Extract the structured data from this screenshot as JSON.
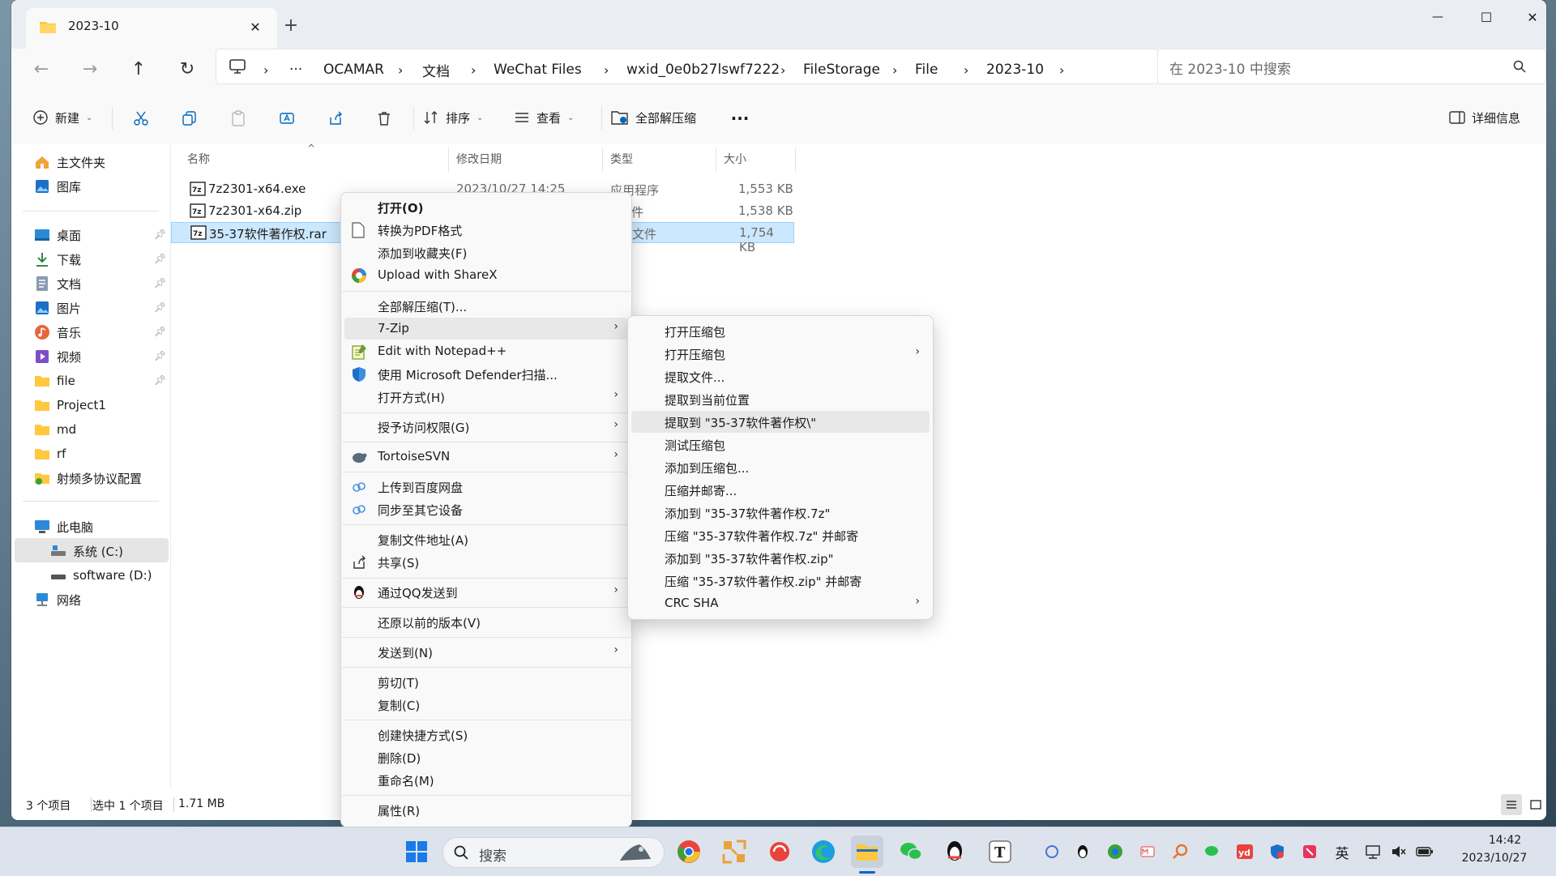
{
  "window": {
    "tab_title": "2023-10",
    "controls": {
      "minimize": "—",
      "maximize": "☐",
      "close": "✕"
    }
  },
  "addressbar": {
    "more": "···",
    "crumbs": [
      "OCAMAR",
      "文档",
      "WeChat Files",
      "wxid_0e0b27lswf7222",
      "FileStorage",
      "File",
      "2023-10"
    ],
    "search_placeholder": "在 2023-10 中搜索"
  },
  "toolbar": {
    "new_label": "新建",
    "sort_label": "排序",
    "view_label": "查看",
    "extract_all_label": "全部解压缩",
    "more_label": "···",
    "details_label": "详细信息"
  },
  "sidebar": {
    "home": "主文件夹",
    "gallery": "图库",
    "pinned": [
      {
        "label": "桌面",
        "icon": "desktop-icon"
      },
      {
        "label": "下载",
        "icon": "download-icon"
      },
      {
        "label": "文档",
        "icon": "documents-icon"
      },
      {
        "label": "图片",
        "icon": "pictures-icon"
      },
      {
        "label": "音乐",
        "icon": "music-icon"
      },
      {
        "label": "视频",
        "icon": "video-icon"
      },
      {
        "label": "file",
        "icon": "folder-icon"
      }
    ],
    "folders": [
      "Project1",
      "md",
      "rf",
      "射频多协议配置"
    ],
    "this_pc": "此电脑",
    "drives": [
      "系统 (C:)",
      "software (D:)"
    ],
    "network": "网络"
  },
  "columns": {
    "name": "名称",
    "modified": "修改日期",
    "type": "类型",
    "size": "大小"
  },
  "files": [
    {
      "name": "7z2301-x64.exe",
      "modified": "2023/10/27 14:25",
      "type": "应用程序",
      "size": "1,553 KB"
    },
    {
      "name": "7z2301-x64.zip",
      "modified": "",
      "type": "件",
      "size": "1,538 KB"
    },
    {
      "name": "35-37软件著作权.rar",
      "modified": "",
      "type": "文件",
      "size": "1,754 KB"
    }
  ],
  "status": {
    "count": "3 个项目",
    "selected": "选中 1 个项目",
    "size": "1.71 MB"
  },
  "context_menu": [
    {
      "label": "打开(O)",
      "bold": true
    },
    {
      "label": "转换为PDF格式"
    },
    {
      "label": "添加到收藏夹(F)"
    },
    {
      "label": "Upload with ShareX"
    },
    {
      "label": "全部解压缩(T)..."
    },
    {
      "label": "7-Zip"
    },
    {
      "label": "Edit with Notepad++"
    },
    {
      "label": "使用 Microsoft Defender扫描..."
    },
    {
      "label": "打开方式(H)"
    },
    {
      "label": "授予访问权限(G)"
    },
    {
      "label": "TortoiseSVN"
    },
    {
      "label": "上传到百度网盘"
    },
    {
      "label": "同步至其它设备"
    },
    {
      "label": "复制文件地址(A)"
    },
    {
      "label": "共享(S)"
    },
    {
      "label": "通过QQ发送到"
    },
    {
      "label": "还原以前的版本(V)"
    },
    {
      "label": "发送到(N)"
    },
    {
      "label": "剪切(T)"
    },
    {
      "label": "复制(C)"
    },
    {
      "label": "创建快捷方式(S)"
    },
    {
      "label": "删除(D)"
    },
    {
      "label": "重命名(M)"
    },
    {
      "label": "属性(R)"
    }
  ],
  "submenu_7zip": [
    "打开压缩包",
    "打开压缩包",
    "提取文件...",
    "提取到当前位置",
    "提取到 \"35-37软件著作权\\\"",
    "测试压缩包",
    "添加到压缩包...",
    "压缩并邮寄...",
    "添加到 \"35-37软件著作权.7z\"",
    "压缩 \"35-37软件著作权.7z\" 并邮寄",
    "添加到 \"35-37软件著作权.zip\"",
    "压缩 \"35-37软件著作权.zip\" 并邮寄",
    "CRC SHA"
  ],
  "taskbar": {
    "search_placeholder": "搜索",
    "ime": "英",
    "time": "14:42",
    "date": "2023/10/27"
  },
  "colors": {
    "accent": "#0067c0",
    "selection": "#cce8ff",
    "folder": "#ffc83d"
  }
}
